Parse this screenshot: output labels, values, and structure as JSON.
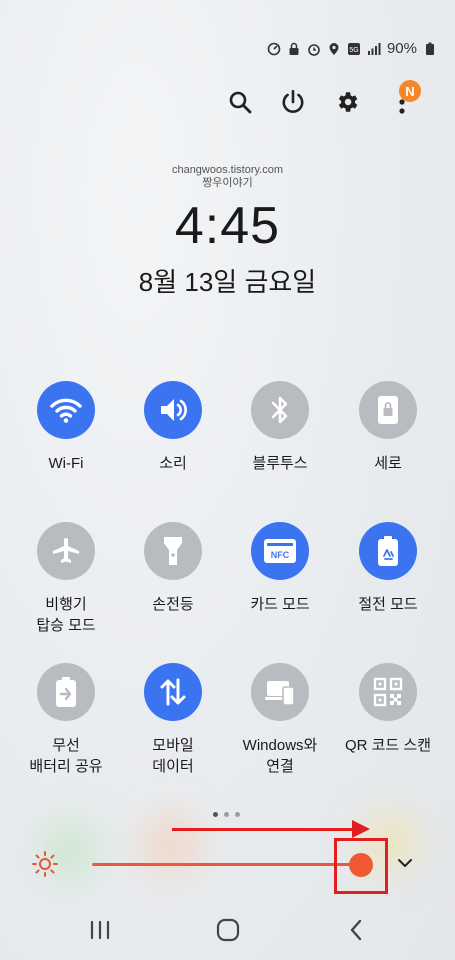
{
  "status_bar": {
    "battery": "90%",
    "icons": [
      "data-saver-icon",
      "lock-icon",
      "alarm-icon",
      "location-icon",
      "5g-icon",
      "signal-icon",
      "battery-icon"
    ]
  },
  "top_actions": {
    "icons": [
      "search-icon",
      "power-icon",
      "gear-icon",
      "more-icon"
    ],
    "notification_badge": "N"
  },
  "clock": {
    "site": "changwoos.tistory.com",
    "site_sub": "짱우이야기",
    "time": "4:45",
    "date": "8월 13일 금요일"
  },
  "tiles": [
    {
      "label": "Wi-Fi",
      "icon": "wifi-icon",
      "on": true
    },
    {
      "label": "소리",
      "icon": "speaker-icon",
      "on": true
    },
    {
      "label": "블루투스",
      "icon": "bluetooth-icon",
      "on": false
    },
    {
      "label": "세로",
      "icon": "portrait-lock-icon",
      "on": false
    },
    {
      "label": "비행기\n탑승 모드",
      "icon": "airplane-icon",
      "on": false
    },
    {
      "label": "손전등",
      "icon": "flashlight-icon",
      "on": false
    },
    {
      "label": "카드 모드",
      "icon": "nfc-icon",
      "on": true
    },
    {
      "label": "절전 모드",
      "icon": "battery-recycle-icon",
      "on": true
    },
    {
      "label": "무선\n배터리 공유",
      "icon": "wireless-powershare-icon",
      "on": false
    },
    {
      "label": "모바일\n데이터",
      "icon": "mobile-data-icon",
      "on": true
    },
    {
      "label": "Windows와\n연결",
      "icon": "link-to-windows-icon",
      "on": false
    },
    {
      "label": "QR 코드 스캔",
      "icon": "qr-icon",
      "on": false
    }
  ],
  "nfc_text": "NFC",
  "brightness": {
    "level": 0.95
  },
  "pager": {
    "pages": 3,
    "current": 0
  },
  "colors": {
    "accent": "#3b74f0",
    "inactive": "#b8bbc0",
    "brightness": "#f05a32",
    "annotation": "#e31e1e",
    "badge": "#f5862a"
  },
  "nav": [
    "recents-icon",
    "home-icon",
    "back-icon"
  ]
}
